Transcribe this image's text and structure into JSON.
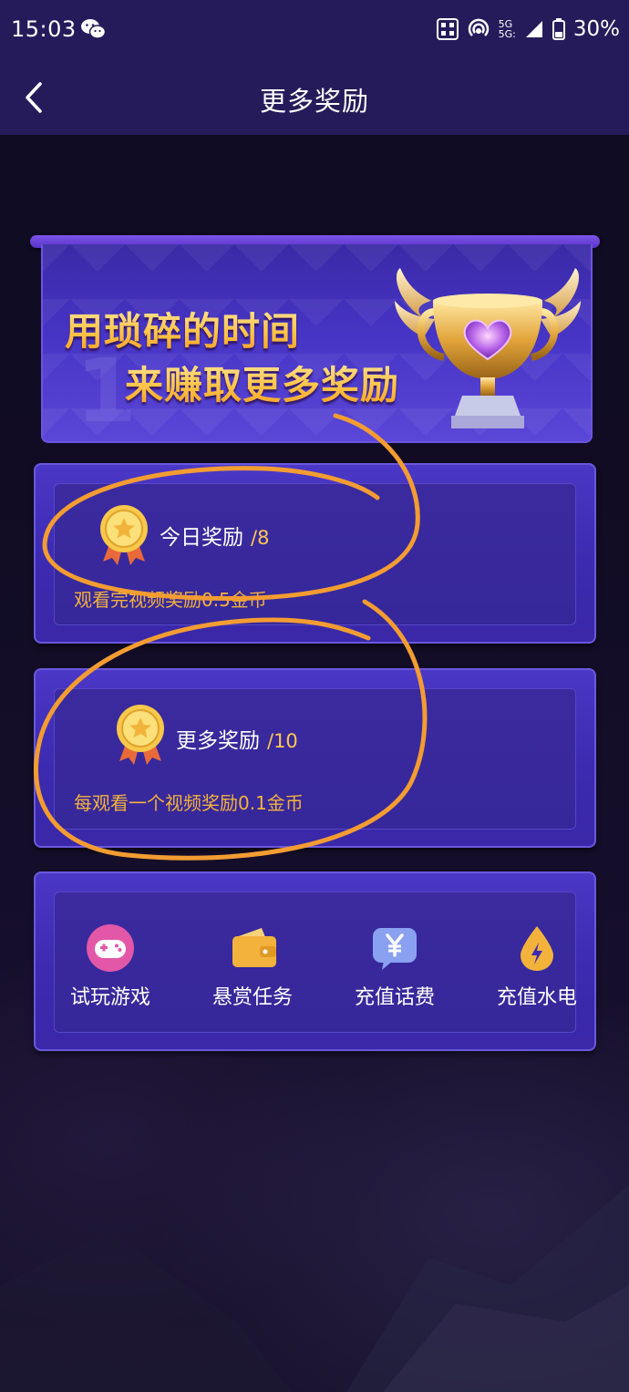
{
  "status_bar": {
    "time": "15:03",
    "network_1": "5G",
    "network_2": "5G:",
    "battery": "30%"
  },
  "nav": {
    "title": "更多奖励"
  },
  "banner": {
    "line1": "用琐碎的时间",
    "line2": "来赚取更多奖励",
    "ghost_number": "1"
  },
  "cards": [
    {
      "label": "今日奖励",
      "count": "/8",
      "description": "观看完视频奖励0.5金币"
    },
    {
      "label": "更多奖励",
      "count": "/10",
      "description": "每观看一个视频奖励0.1金币"
    }
  ],
  "shortcuts": [
    {
      "label": "试玩游戏",
      "icon": "gamepad-icon",
      "color": "#e257a8"
    },
    {
      "label": "悬赏任务",
      "icon": "wallet-icon",
      "color": "#f3b23c"
    },
    {
      "label": "充值话费",
      "icon": "yuan-chat-icon",
      "color": "#8aa0f0"
    },
    {
      "label": "充值水电",
      "icon": "water-drop-icon",
      "color": "#f3b23c"
    }
  ],
  "colors": {
    "header_bg": "#261b5a",
    "card_bg": "#3c2ab0",
    "accent_gold": "#ffc850",
    "annotation_orange": "#f39c32"
  }
}
